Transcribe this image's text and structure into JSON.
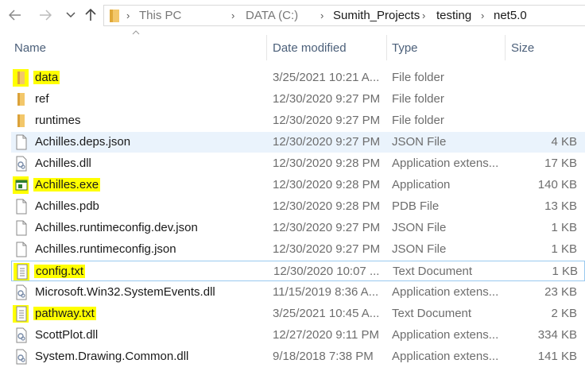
{
  "address": {
    "segments": [
      "This PC",
      "DATA (C:)",
      "Sumith_Projects",
      "testing",
      "net5.0"
    ]
  },
  "columns": {
    "name": "Name",
    "date": "Date modified",
    "type": "Type",
    "size": "Size"
  },
  "files": [
    {
      "name": "data",
      "date": "3/25/2021 10:21 A...",
      "type": "File folder",
      "size": "",
      "icon": "folder-icon",
      "highlight": true
    },
    {
      "name": "ref",
      "date": "12/30/2020 9:27 PM",
      "type": "File folder",
      "size": "",
      "icon": "folder-icon",
      "highlight": false
    },
    {
      "name": "runtimes",
      "date": "12/30/2020 9:27 PM",
      "type": "File folder",
      "size": "",
      "icon": "folder-icon",
      "highlight": false
    },
    {
      "name": "Achilles.deps.json",
      "date": "12/30/2020 9:27 PM",
      "type": "JSON File",
      "size": "4 KB",
      "icon": "document-icon",
      "highlight": false
    },
    {
      "name": "Achilles.dll",
      "date": "12/30/2020 9:28 PM",
      "type": "Application extens...",
      "size": "17 KB",
      "icon": "dll-icon",
      "highlight": false
    },
    {
      "name": "Achilles.exe",
      "date": "12/30/2020 9:28 PM",
      "type": "Application",
      "size": "140 KB",
      "icon": "exe-icon",
      "highlight": true
    },
    {
      "name": "Achilles.pdb",
      "date": "12/30/2020 9:28 PM",
      "type": "PDB File",
      "size": "13 KB",
      "icon": "document-icon",
      "highlight": false
    },
    {
      "name": "Achilles.runtimeconfig.dev.json",
      "date": "12/30/2020 9:27 PM",
      "type": "JSON File",
      "size": "1 KB",
      "icon": "document-icon",
      "highlight": false
    },
    {
      "name": "Achilles.runtimeconfig.json",
      "date": "12/30/2020 9:27 PM",
      "type": "JSON File",
      "size": "1 KB",
      "icon": "document-icon",
      "highlight": false
    },
    {
      "name": "config.txt",
      "date": "12/30/2020 10:07 ...",
      "type": "Text Document",
      "size": "1 KB",
      "icon": "text-file-icon",
      "highlight": true
    },
    {
      "name": "Microsoft.Win32.SystemEvents.dll",
      "date": "11/15/2019 8:36 A...",
      "type": "Application extens...",
      "size": "23 KB",
      "icon": "dll-icon",
      "highlight": false
    },
    {
      "name": "pathway.txt",
      "date": "3/25/2021 10:45 A...",
      "type": "Text Document",
      "size": "2 KB",
      "icon": "text-file-icon",
      "highlight": true
    },
    {
      "name": "ScottPlot.dll",
      "date": "12/27/2020 9:11 PM",
      "type": "Application extens...",
      "size": "334 KB",
      "icon": "dll-icon",
      "highlight": false
    },
    {
      "name": "System.Drawing.Common.dll",
      "date": "9/18/2018 7:38 PM",
      "type": "Application extens...",
      "size": "141 KB",
      "icon": "dll-icon",
      "highlight": false
    }
  ],
  "colors": {
    "highlight": "#ffff00",
    "folder": "#e8b84a",
    "selection": "#eaf3fc",
    "focus_border": "#99c9ef",
    "header_text": "#4c607a"
  }
}
